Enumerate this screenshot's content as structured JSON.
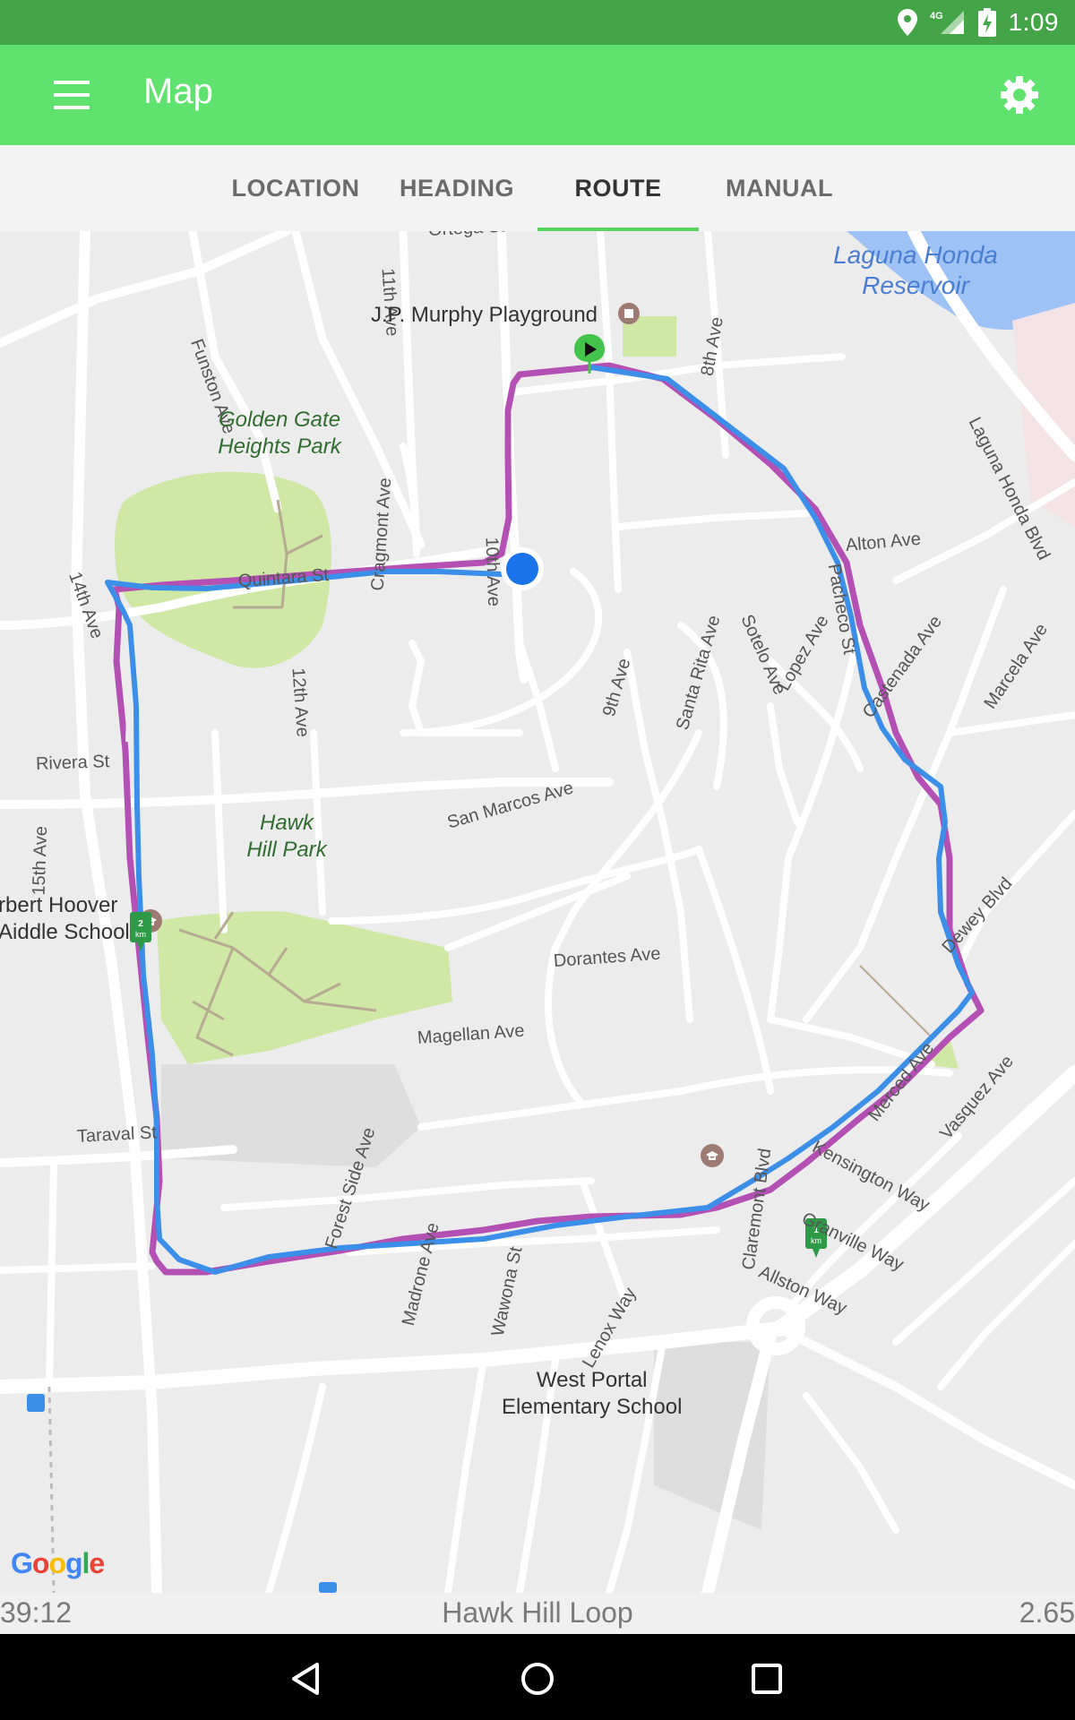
{
  "status_bar": {
    "time": "1:09",
    "network": "4G",
    "icons": [
      "location-icon",
      "signal-icon",
      "battery-charging-icon"
    ]
  },
  "app_bar": {
    "title": "Map",
    "menu_icon": "hamburger-menu-icon",
    "settings_icon": "gear-icon"
  },
  "tabs": [
    {
      "label": "LOCATION",
      "active": false
    },
    {
      "label": "HEADING",
      "active": false
    },
    {
      "label": "ROUTE",
      "active": true
    },
    {
      "label": "MANUAL",
      "active": false
    }
  ],
  "map": {
    "streets": {
      "ortega": "Ortega St",
      "11th": "11th Ave",
      "funston": "Funston Ave",
      "8th": "8th Ave",
      "laguna_honda_blvd": "Laguna Honda Blvd",
      "alton": "Alton Ave",
      "cragmont": "Cragmont Ave",
      "10th": "10th Ave",
      "14th": "14th Ave",
      "quintara": "Quintara St",
      "pacheco": "Pacheco St",
      "12th": "12th Ave",
      "sotelo": "Sotelo Ave",
      "santa_rita": "Santa Rita Ave",
      "lopez": "Lopez Ave",
      "castenada": "Castenada Ave",
      "marcela": "Marcela Ave",
      "9th": "9th Ave",
      "rivera": "Rivera St",
      "san_marcos": "San Marcos Ave",
      "15th": "15th Ave",
      "dewey": "Dewey Blvd",
      "dorantes": "Dorantes Ave",
      "magellan": "Magellan Ave",
      "merced": "Merced Ave",
      "vasquez": "Vasquez Ave",
      "kensington": "Kensington Way",
      "taraval": "Taraval St",
      "granville": "Granville Way",
      "claremont": "Claremont Blvd",
      "forest_side": "Forest Side Ave",
      "madrone": "Madrone Ave",
      "wawona": "Wawona St",
      "lenox": "Lenox Way",
      "allston": "Allston Way"
    },
    "places": {
      "playground": "J.P. Murphy Playground",
      "golden_gate_park": [
        "Golden Gate",
        "Heights Park"
      ],
      "hawk_hill_park": [
        "Hawk",
        "Hill Park"
      ],
      "reservoir": [
        "Laguna Honda",
        "Reservoir"
      ],
      "hoover_school": [
        "rbert Hoover",
        "Aiddle School"
      ],
      "west_portal_school": [
        "West Portal",
        "Elementary School"
      ]
    },
    "km_markers": [
      "2 km",
      "1 km"
    ],
    "attribution": "Google",
    "colors": {
      "route_planned": "#b44fb4",
      "route_tracked": "#3b8fe8",
      "current_location": "#1a73e8",
      "start_marker": "#43c34a",
      "km_marker": "#2e9a48",
      "park": "#cfe8a6",
      "water": "#9ec2f5"
    }
  },
  "info_bar": {
    "elapsed": "39:12",
    "route_name": "Hawk Hill Loop",
    "distance": "2.65"
  },
  "nav_bar": {
    "icons": [
      "back-icon",
      "home-icon",
      "recents-icon"
    ]
  }
}
